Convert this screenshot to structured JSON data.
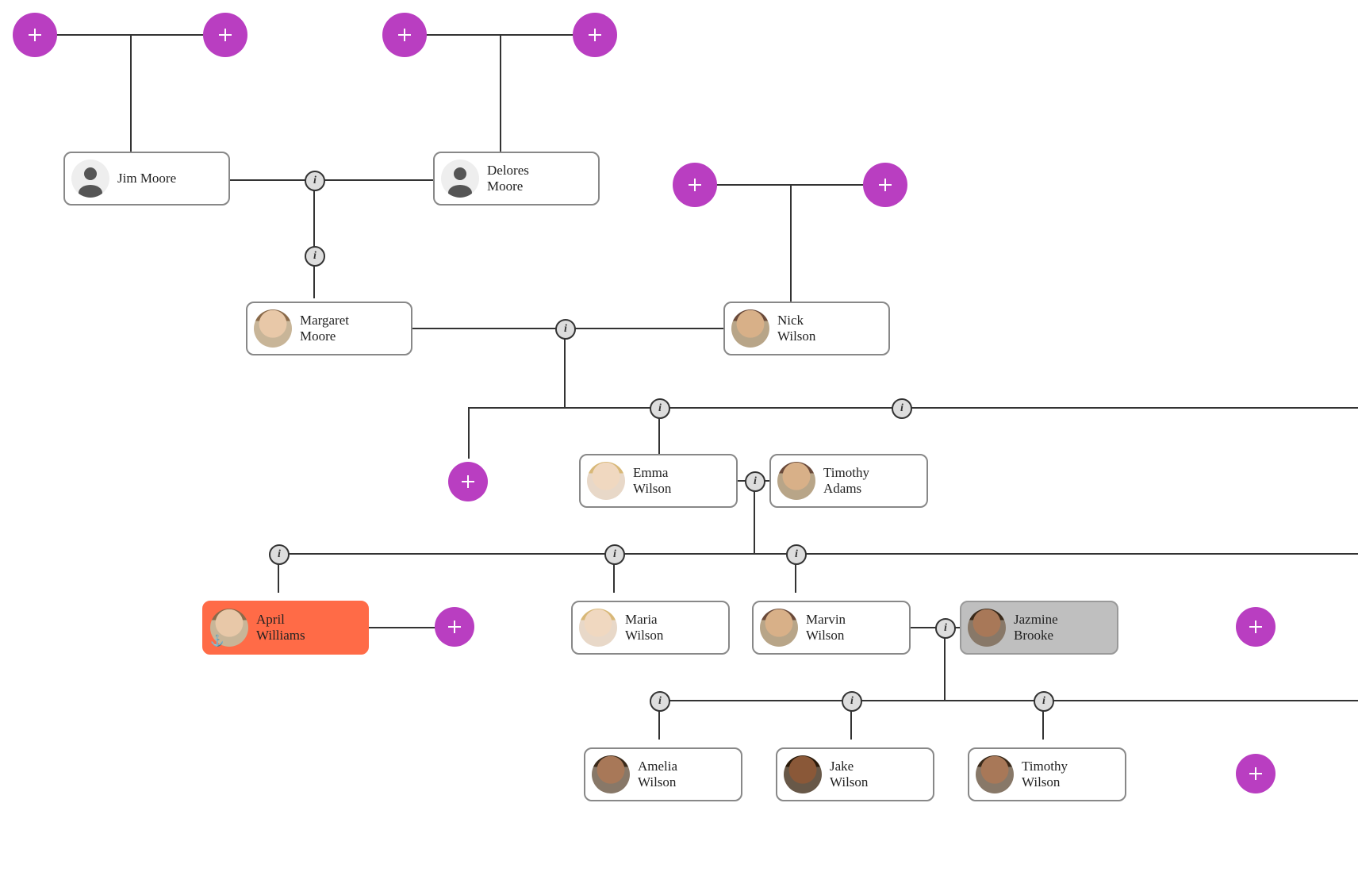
{
  "people": {
    "jim": {
      "first": "Jim",
      "last": "Moore"
    },
    "delores": {
      "first": "Delores",
      "last": "Moore"
    },
    "margaret": {
      "first": "Margaret",
      "last": "Moore"
    },
    "nick": {
      "first": "Nick",
      "last": "Wilson"
    },
    "emma": {
      "first": "Emma",
      "last": "Wilson"
    },
    "timothyA": {
      "first": "Timothy",
      "last": "Adams"
    },
    "april": {
      "first": "April",
      "last": "Williams"
    },
    "maria": {
      "first": "Maria",
      "last": "Wilson"
    },
    "marvin": {
      "first": "Marvin",
      "last": "Wilson"
    },
    "jazmine": {
      "first": "Jazmine",
      "last": "Brooke"
    },
    "amelia": {
      "first": "Amelia",
      "last": "Wilson"
    },
    "jake": {
      "first": "Jake",
      "last": "Wilson"
    },
    "timothyW": {
      "first": "Timothy",
      "last": "Wilson"
    }
  },
  "highlight": {
    "anchor": "april",
    "secondary": "jazmine"
  },
  "colors": {
    "add": "#b93ec1",
    "highlight": "#ff6b47",
    "secondary": "#bfbfbf",
    "line": "#333333"
  },
  "icons": {
    "add": "+",
    "info": "i",
    "anchor": "⚓"
  }
}
